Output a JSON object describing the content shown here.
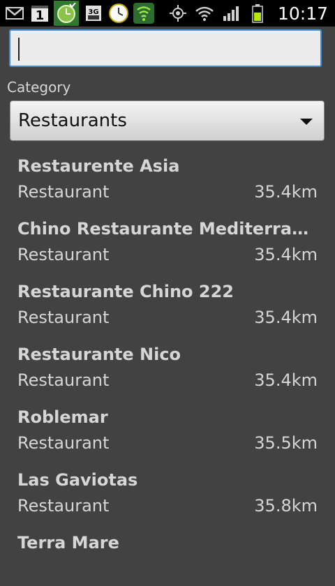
{
  "status_bar": {
    "time": "10:17",
    "left_icons": [
      "gmail-icon",
      "calendar-icon",
      "clock-widget-icon",
      "3g-data-icon",
      "alarm-clock-icon",
      "vpn-shield-icon"
    ],
    "right_icons": [
      "gps-icon",
      "wifi-icon",
      "signal-icon",
      "battery-icon"
    ],
    "calendar_day": "1",
    "data_type": "3G"
  },
  "search": {
    "value": "",
    "placeholder": ""
  },
  "category": {
    "label": "Category",
    "selected": "Restaurants"
  },
  "results": [
    {
      "name": "Restaurente Asia",
      "type": "Restaurant",
      "distance": "35.4km"
    },
    {
      "name": "Chino Restaurante Mediterraneo",
      "type": "Restaurant",
      "distance": "35.4km"
    },
    {
      "name": "Restaurante Chino 222",
      "type": "Restaurant",
      "distance": "35.4km"
    },
    {
      "name": "Restaurante Nico",
      "type": "Restaurant",
      "distance": "35.4km"
    },
    {
      "name": "Roblemar",
      "type": "Restaurant",
      "distance": "35.5km"
    },
    {
      "name": "Las Gaviotas",
      "type": "Restaurant",
      "distance": "35.8km"
    },
    {
      "name": "Terra Mare",
      "type": "",
      "distance": ""
    }
  ],
  "colors": {
    "background": "#424242",
    "accent_focus": "#3e8fd8",
    "text_primary": "#d6d6d6"
  }
}
